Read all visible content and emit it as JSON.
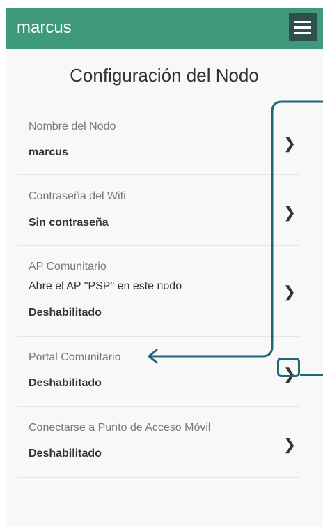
{
  "header": {
    "app_title": "marcus",
    "menu_icon": "hamburger-menu-icon",
    "background_color": "#3f9a7d"
  },
  "page": {
    "title": "Configuración del Nodo"
  },
  "items": [
    {
      "label": "Nombre del Nodo",
      "value": "marcus",
      "icon": "chevron-right-icon"
    },
    {
      "label": "Contraseña del Wifi",
      "value": "Sin contraseña",
      "icon": "chevron-right-icon"
    },
    {
      "label": "AP Comunitario",
      "description": "Abre el AP \"PSP\" en este nodo",
      "value": "Deshabilitado",
      "icon": "chevron-right-icon"
    },
    {
      "label": "Portal Comunitario",
      "value": "Deshabilitado",
      "icon": "chevron-right-icon"
    },
    {
      "label": "Conectarse a Punto de Acceso Móvil",
      "value": "Deshabilitado",
      "icon": "chevron-right-icon"
    }
  ],
  "annotation": {
    "color": "#20677a",
    "highlighted_item": "Portal Comunitario"
  }
}
